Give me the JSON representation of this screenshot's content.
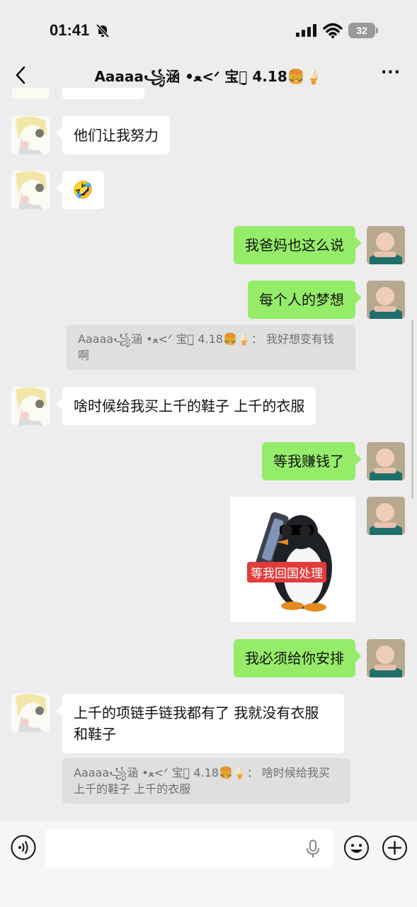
{
  "status_bar": {
    "time": "01:41",
    "battery": "32"
  },
  "header": {
    "title": "Aaaaa꧁涵 •ﻌ<ᐟ 宝ꪔ̤̮ 4.18🍔🍦",
    "more": "···"
  },
  "messages": [
    {
      "side": "left",
      "type": "emoji",
      "emoji": "🤣",
      "text": "他们让我努力"
    },
    {
      "side": "right",
      "text": "我爸妈也这么说"
    },
    {
      "side": "right",
      "text": "每个人的梦想"
    },
    {
      "quote": "Aaaaa꧁涵 •ﻌ<ᐟ 宝ꪔ̤̮ 4.18🍔🍦： 我好想变有钱啊"
    },
    {
      "side": "left",
      "text": "啥时候给我买上千的鞋子 上千的衣服"
    },
    {
      "side": "right",
      "text": "等我赚钱了"
    },
    {
      "side": "right",
      "type": "sticker",
      "caption": "等我回国处理"
    },
    {
      "side": "right",
      "text": "我必须给你安排"
    },
    {
      "side": "left",
      "text": "上千的项链手链我都有了 我就没有衣服和鞋子"
    },
    {
      "quote": "Aaaaa꧁涵 •ﻌ<ᐟ 宝ꪔ̤̮ 4.18🍔🍦： 啥时候给我买上千的鞋子 上千的衣服"
    }
  ],
  "colors": {
    "accent_green": "#95ec69",
    "background": "#ededed"
  },
  "icons": [
    "back-icon",
    "more-icon",
    "voice-icon",
    "microphone-icon",
    "emoji-icon",
    "plus-icon",
    "bell-off-icon",
    "signal-icon",
    "wifi-icon",
    "battery-icon"
  ]
}
